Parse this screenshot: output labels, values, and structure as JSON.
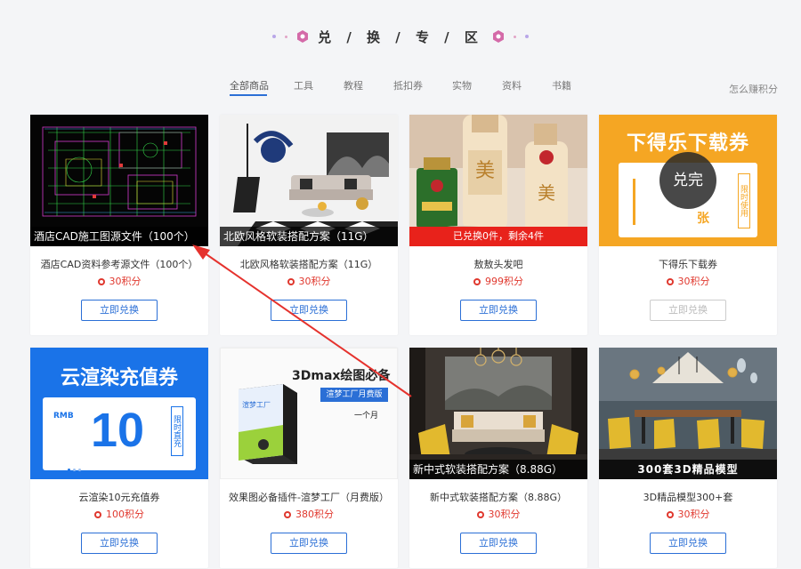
{
  "header": {
    "title": "兑 / 换 / 专 / 区"
  },
  "tabs": [
    {
      "label": "全部商品",
      "active": true
    },
    {
      "label": "工具"
    },
    {
      "label": "教程"
    },
    {
      "label": "抵扣券"
    },
    {
      "label": "实物"
    },
    {
      "label": "资料"
    },
    {
      "label": "书籍"
    }
  ],
  "earn_link": "怎么赚积分",
  "products": [
    {
      "caption": "酒店CAD施工图源文件（100个）",
      "title": "酒店CAD资料参考源文件（100个）",
      "points": "30积分",
      "button": "立即兑换"
    },
    {
      "caption": "北欧风格软装搭配方案（11G）",
      "title": "北欧风格软装搭配方案（11G）",
      "points": "30积分",
      "button": "立即兑换"
    },
    {
      "caption": "已兑换0件，剩余4件",
      "title": "敖敖头发吧",
      "points": "999积分",
      "button": "立即兑换"
    },
    {
      "title": "下得乐下载券",
      "points": "30积分",
      "button": "立即兑换",
      "image_headline": "下得乐下载券",
      "image_badge": "兑完",
      "image_side": "限时使用",
      "image_unit": "张"
    },
    {
      "title": "云渲染10元充值券",
      "points": "100积分",
      "button": "立即兑换",
      "image_headline": "云渲染充值券",
      "image_currency": "RMB",
      "image_amount": "10",
      "image_side": "限时直充"
    },
    {
      "title": "效果图必备插件-渲梦工厂（月费版）",
      "points": "380积分",
      "button": "立即兑换",
      "image_headline": "3Dmax绘图必备",
      "image_subtitle": "渲梦工厂月费版",
      "image_period": "一个月",
      "image_box_label": "渲梦工厂"
    },
    {
      "caption": "新中式软装搭配方案（8.88G）",
      "title": "新中式软装搭配方案（8.88G）",
      "points": "30积分",
      "button": "立即兑换"
    },
    {
      "caption": "300套3D精品模型",
      "title": "3D精品模型300+套",
      "points": "30积分",
      "button": "立即兑换"
    }
  ],
  "colors": {
    "accent": "#2b6fd6",
    "points": "#e0382e",
    "arrow": "#e5322d"
  }
}
